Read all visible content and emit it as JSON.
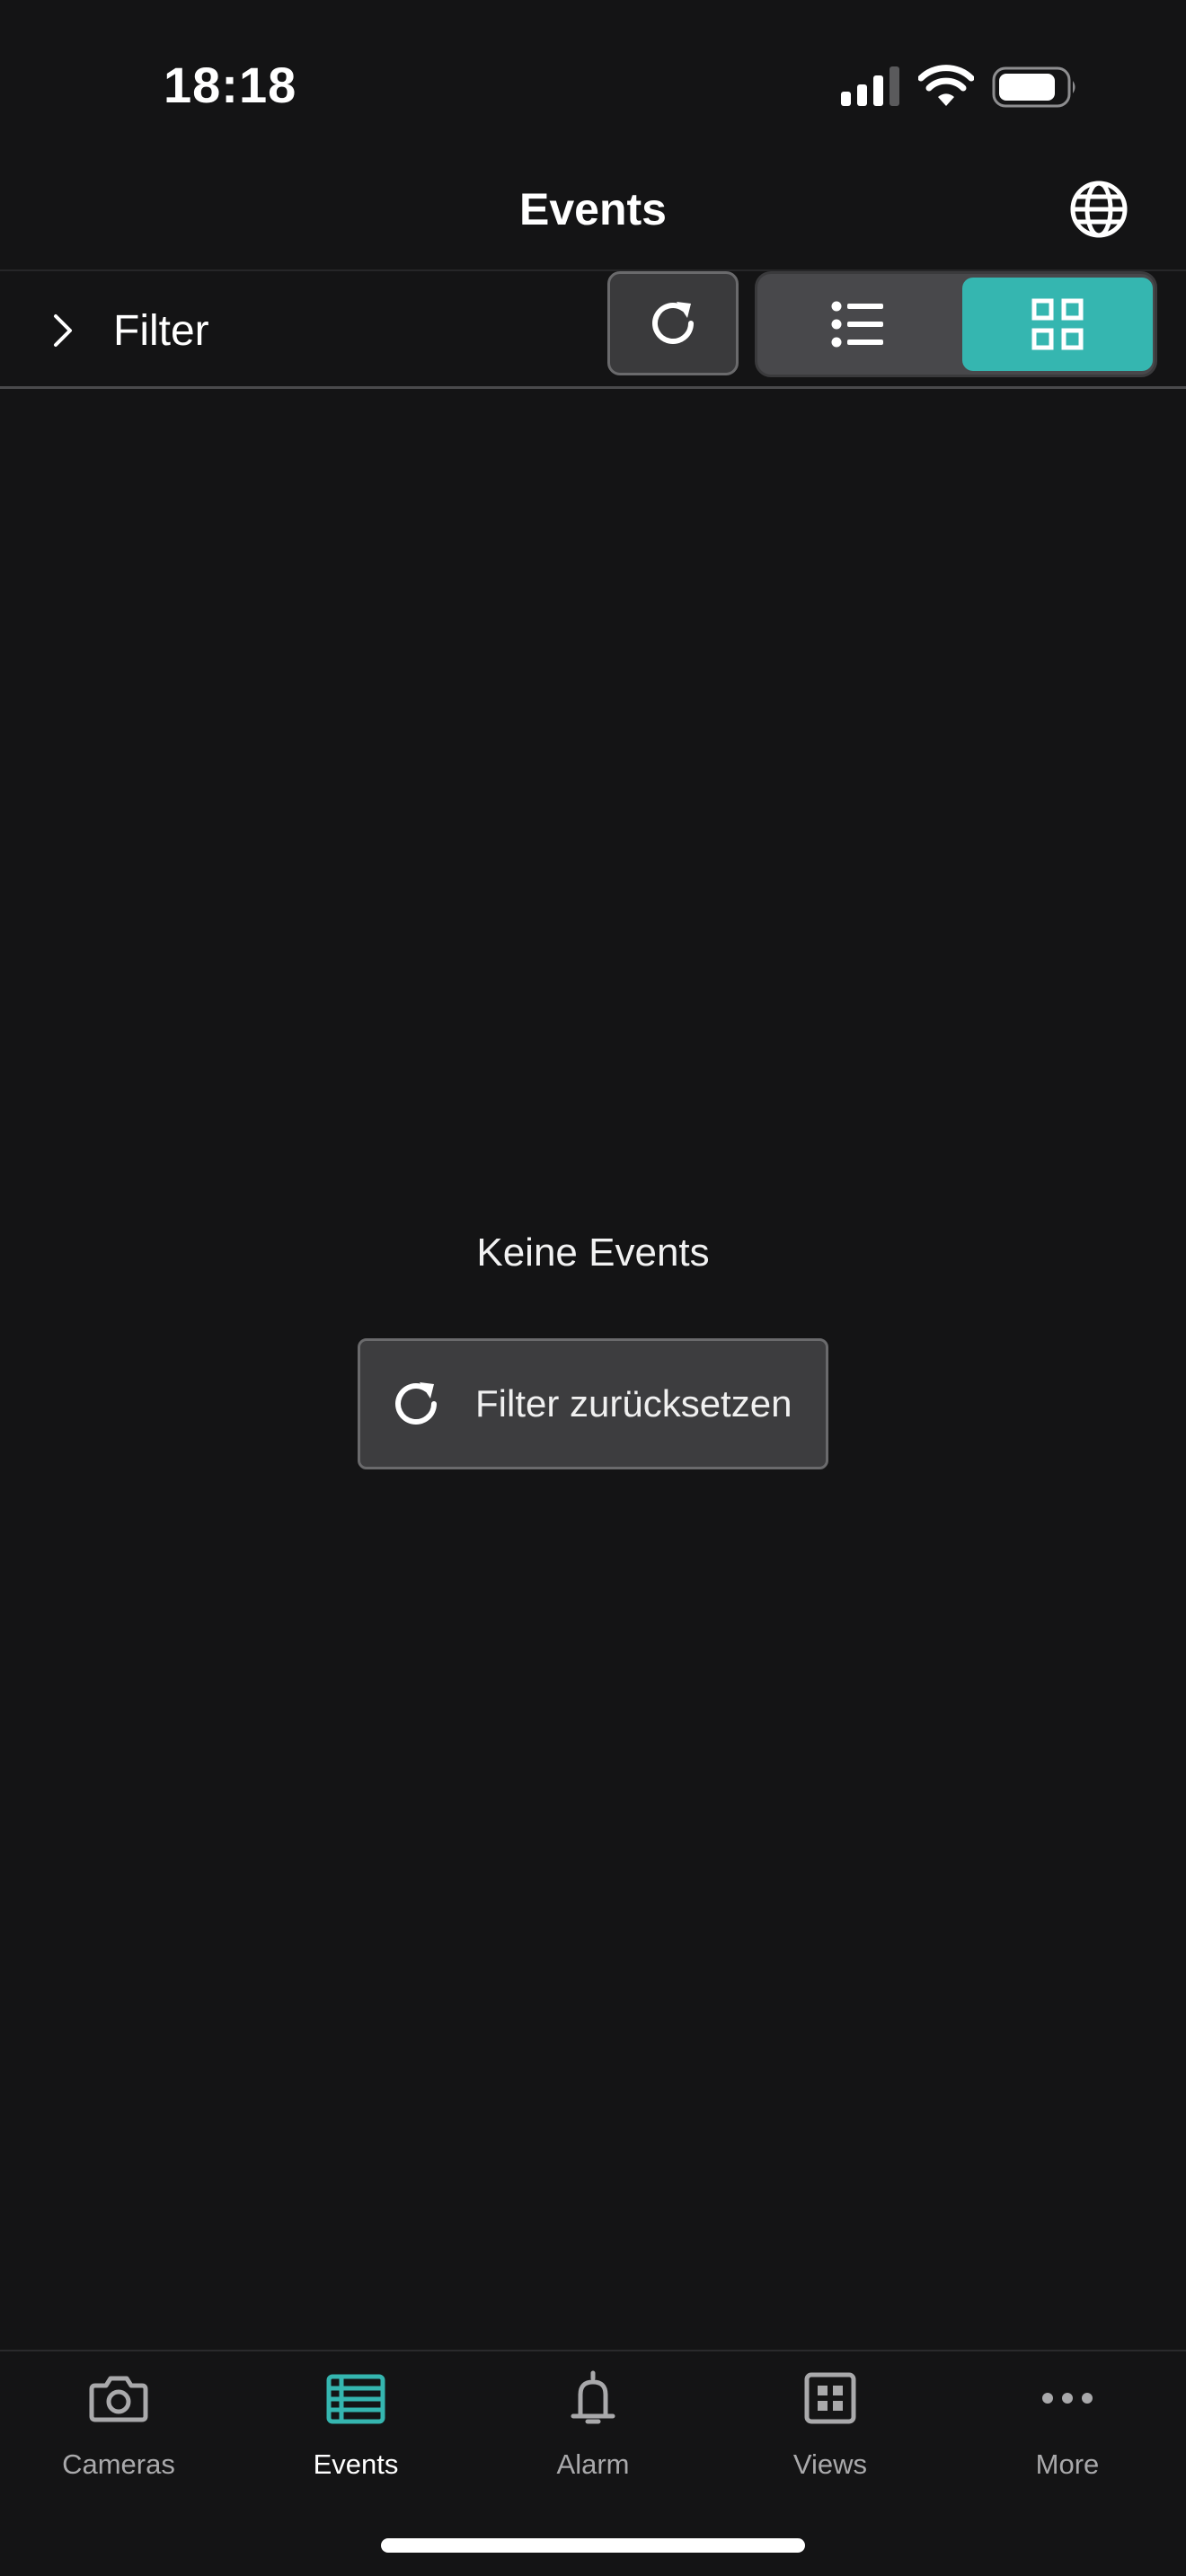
{
  "status_bar": {
    "time": "18:18",
    "battery_level": 0.8
  },
  "header": {
    "title": "Events"
  },
  "toolbar": {
    "filter_label": "Filter",
    "view_mode": "grid"
  },
  "empty_state": {
    "message": "Keine Events",
    "reset_label": "Filter zurücksetzen"
  },
  "tabs": [
    {
      "id": "cameras",
      "label": "Cameras",
      "icon": "camera-icon",
      "active": false
    },
    {
      "id": "events",
      "label": "Events",
      "icon": "events-list-icon",
      "active": true
    },
    {
      "id": "alarm",
      "label": "Alarm",
      "icon": "bell-icon",
      "active": false
    },
    {
      "id": "views",
      "label": "Views",
      "icon": "views-grid-icon",
      "active": false
    },
    {
      "id": "more",
      "label": "More",
      "icon": "more-dots-icon",
      "active": false
    }
  ],
  "colors": {
    "accent": "#35b6b0",
    "background": "#141415",
    "button_bg": "#3d3d3f"
  }
}
